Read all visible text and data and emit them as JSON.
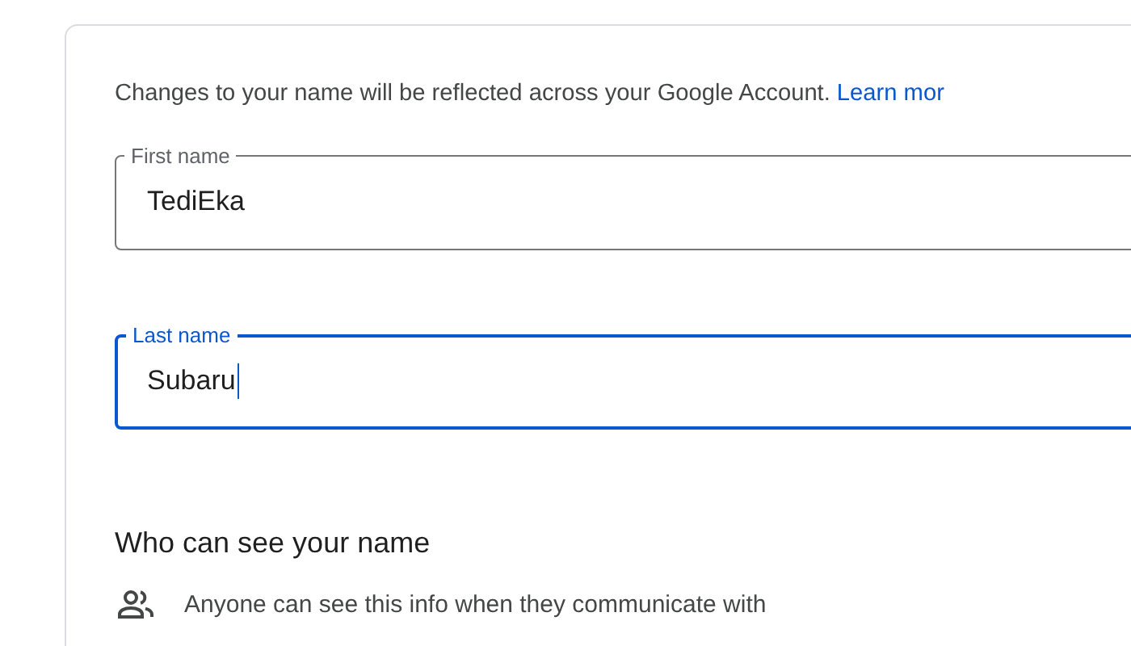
{
  "intro": {
    "text": "Changes to your name will be reflected across your Google Account.",
    "link": "Learn mor"
  },
  "fields": [
    {
      "label": "First name",
      "value": "TediEka",
      "focused": false
    },
    {
      "label": "Last name",
      "value": "Subaru",
      "focused": true
    }
  ],
  "visibility": {
    "heading": "Who can see your name",
    "text": "Anyone can see this info when they communicate with"
  }
}
